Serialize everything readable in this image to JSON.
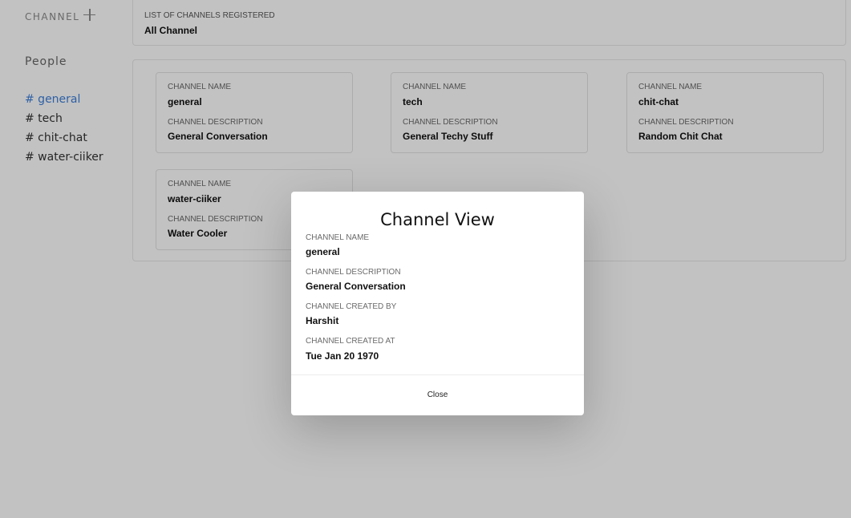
{
  "sidebar": {
    "channel_label": "CHANNEL",
    "people_label": "People",
    "channels": [
      {
        "label": "# general",
        "active": true
      },
      {
        "label": "# tech",
        "active": false
      },
      {
        "label": "# chit-chat",
        "active": false
      },
      {
        "label": "# water-ciiker",
        "active": false
      }
    ],
    "accent_color": "#3d7fd9"
  },
  "header": {
    "subtitle": "LIST OF CHANNELS REGISTERED",
    "title": "All Channel"
  },
  "cards": [
    {
      "name_label": "CHANNEL NAME",
      "name": "general",
      "desc_label": "CHANNEL DESCRIPTION",
      "description": "General Conversation"
    },
    {
      "name_label": "CHANNEL NAME",
      "name": "tech",
      "desc_label": "CHANNEL DESCRIPTION",
      "description": "General Techy Stuff"
    },
    {
      "name_label": "CHANNEL NAME",
      "name": "chit-chat",
      "desc_label": "CHANNEL DESCRIPTION",
      "description": "Random Chit Chat"
    },
    {
      "name_label": "CHANNEL NAME",
      "name": "water-ciiker",
      "desc_label": "CHANNEL DESCRIPTION",
      "description": "Water Cooler"
    }
  ],
  "modal": {
    "title": "Channel View",
    "name_label": "CHANNEL NAME",
    "name": "general",
    "desc_label": "CHANNEL DESCRIPTION",
    "description": "General Conversation",
    "created_by_label": "CHANNEL CREATED BY",
    "created_by": "Harshit",
    "created_at_label": "CHANNEL CREATED AT",
    "created_at": "Tue Jan 20 1970",
    "close_label": "Close"
  }
}
